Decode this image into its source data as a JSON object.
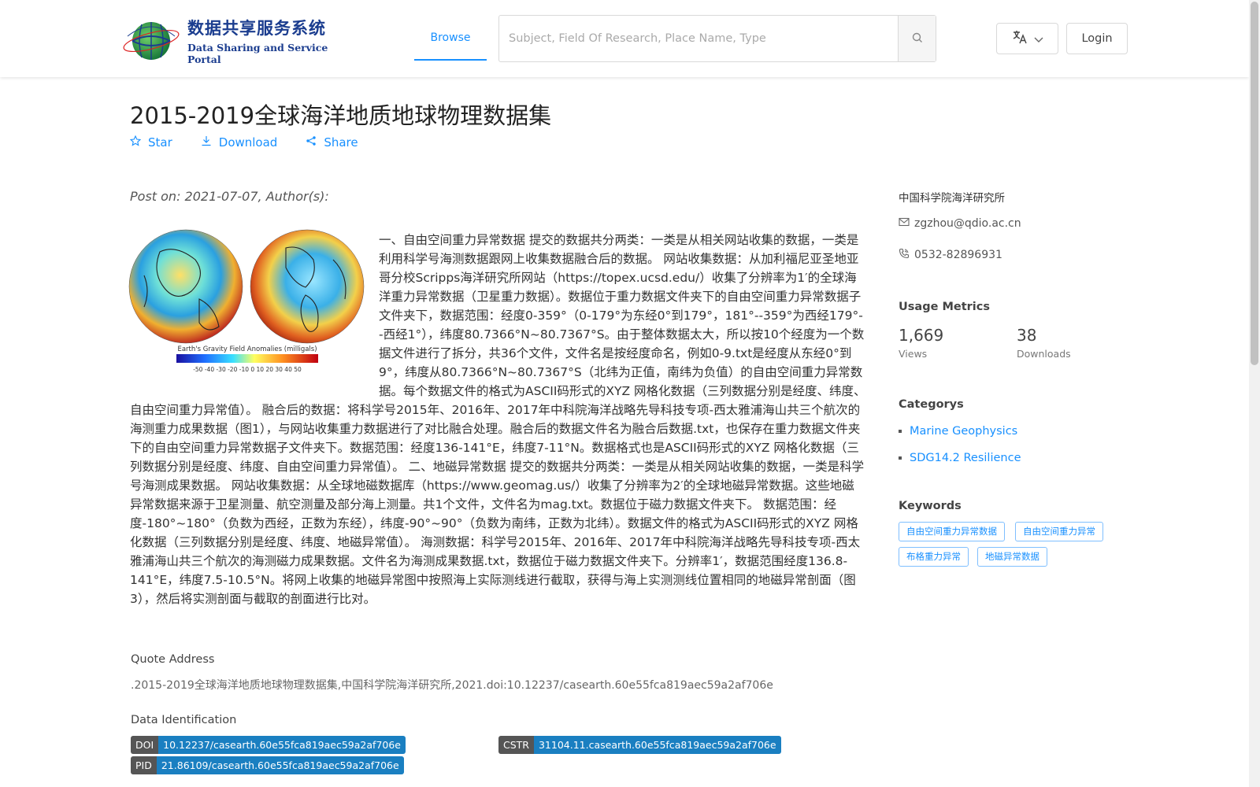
{
  "header": {
    "logo_cn": "数据共享服务系统",
    "logo_en": "Data Sharing and Service Portal",
    "logo_ring_text": "地球大数据科学数据中心",
    "nav_browse": "Browse",
    "search_placeholder": "Subject, Field Of Research, Place Name, Type",
    "login": "Login"
  },
  "dataset": {
    "title": "2015-2019全球海洋地质地球物理数据集",
    "actions": {
      "star": "Star",
      "download": "Download",
      "share": "Share"
    },
    "post_on": "Post on: 2021-07-07, Author(s):",
    "image_caption": "Earth's Gravity Field Anomalies (milligals)",
    "image_scale": "-50 -40 -30 -20 -10 0 10 20 30 40 50",
    "description": "一、自由空间重力异常数据 提交的数据共分两类：一类是从相关网站收集的数据，一类是利用科学号海测数据跟网上收集数据融合后的数据。 网站收集数据：从加利福尼亚圣地亚哥分校Scripps海洋研究所网站（https://topex.ucsd.edu/）收集了分辨率为1′的全球海洋重力异常数据（卫星重力数据）。数据位于重力数据文件夹下的自由空间重力异常数据子文件夹下，数据范围：经度0-359°（0-179°为东经0°到179°，181°--359°为西经179°--西经1°），纬度80.7366°N~80.7367°S。由于整体数据太大，所以按10个经度为一个数据文件进行了拆分，共36个文件，文件名是按经度命名，例如0-9.txt是经度从东经0°到9°，纬度从80.7366°N~80.7367°S（北纬为正值，南纬为负值）的自由空间重力异常数据。每个数据文件的格式为ASCII码形式的XYZ 网格化数据（三列数据分别是经度、纬度、自由空间重力异常值）。 融合后的数据：将科学号2015年、2016年、2017年中科院海洋战略先导科技专项-西太雅浦海山共三个航次的海测重力成果数据（图1），与网站收集重力数据进行了对比融合处理。融合后的数据文件名为融合后数据.txt，也保存在重力数据文件夹下的自由空间重力异常数据子文件夹下。数据范围：经度136-141°E，纬度7-11°N。数据格式也是ASCII码形式的XYZ 网格化数据（三列数据分别是经度、纬度、自由空间重力异常值）。 二、地磁异常数据 提交的数据共分两类：一类是从相关网站收集的数据，一类是科学号海测成果数据。 网站收集数据：从全球地磁数据库（https://www.geomag.us/）收集了分辨率为2′的全球地磁异常数据。这些地磁异常数据来源于卫星测量、航空测量及部分海上测量。共1个文件，文件名为mag.txt。数据位于磁力数据文件夹下。 数据范围：经度-180°~180°（负数为西经，正数为东经），纬度-90°~90°（负数为南纬，正数为北纬）。数据文件的格式为ASCII码形式的XYZ 网格化数据（三列数据分别是经度、纬度、地磁异常值）。 海测数据：科学号2015年、2016年、2017年中科院海洋战略先导科技专项-西太雅浦海山共三个航次的海测磁力成果数据。文件名为海测成果数据.txt，数据位于磁力数据文件夹下。分辨率1′，数据范围经度136.8-141°E，纬度7.5-10.5°N。将网上收集的地磁异常图中按照海上实际测线进行截取，获得与海上实测测线位置相同的地磁异常剖面（图3），然后将实测剖面与截取的剖面进行比对。",
    "quote_label": "Quote Address",
    "quote_text": ".2015-2019全球海洋地质地球物理数据集,中国科学院海洋研究所,2021.doi:10.12237/casearth.60e55fca819aec59a2af706e",
    "ident_label": "Data Identification",
    "identifiers": {
      "doi_key": "DOI",
      "doi_val": "10.12237/casearth.60e55fca819aec59a2af706e",
      "cstr_key": "CSTR",
      "cstr_val": "31104.11.casearth.60e55fca819aec59a2af706e",
      "pid_key": "PID",
      "pid_val": "21.86109/casearth.60e55fca819aec59a2af706e"
    }
  },
  "sidebar": {
    "institution": "中国科学院海洋研究所",
    "email": "zgzhou@qdio.ac.cn",
    "phone": "0532-82896931",
    "metrics_title": "Usage Metrics",
    "views_count": "1,669",
    "views_label": "Views",
    "downloads_count": "38",
    "downloads_label": "Downloads",
    "categories_title": "Categorys",
    "categories": [
      "Marine Geophysics",
      "SDG14.2 Resilience"
    ],
    "keywords_title": "Keywords",
    "keywords": [
      "自由空间重力异常数据",
      "自由空间重力异常",
      "布格重力异常",
      "地磁异常数据"
    ]
  },
  "colors": {
    "accent": "#1890ff",
    "badge_value": "#1a7fc1",
    "badge_key": "#555555",
    "logo_blue": "#1b3d8f"
  }
}
